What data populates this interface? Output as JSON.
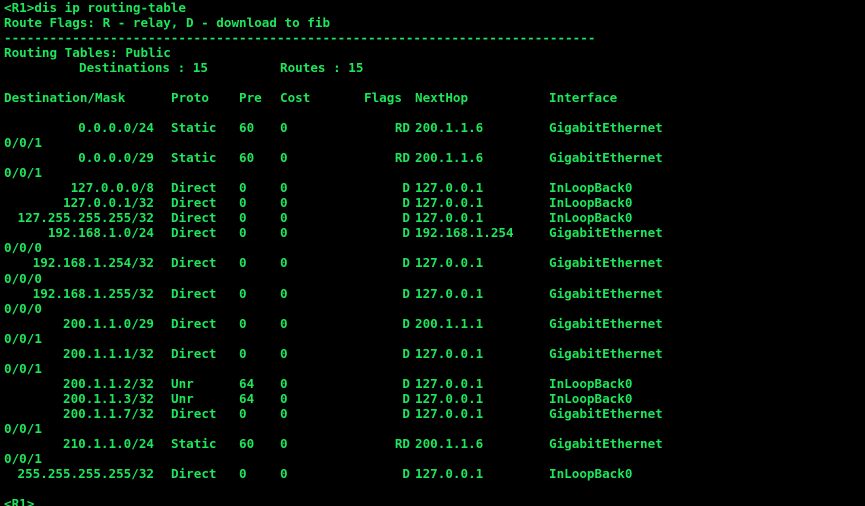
{
  "terminal": {
    "command_line": "<R1>dis ip routing-table",
    "flags_line": "Route Flags: R - relay, D - download to fib",
    "separator": "------------------------------------------------------------------------------",
    "table_title": "Routing Tables: Public",
    "destinations_label": "Destinations : 15",
    "routes_label": "Routes : 15",
    "prompt": "<R1>"
  },
  "headers": {
    "dest": "Destination/Mask",
    "proto": "Proto",
    "pre": "Pre",
    "cost": "Cost",
    "flags": "Flags",
    "nexthop": "NextHop",
    "interface": "Interface"
  },
  "routes": [
    {
      "dest": "0.0.0.0/24",
      "proto": "Static",
      "pre": "60",
      "cost": "0",
      "flags": "RD",
      "nexthop": "200.1.1.6",
      "iface": "GigabitEthernet",
      "iface2": "0/0/1"
    },
    {
      "dest": "0.0.0.0/29",
      "proto": "Static",
      "pre": "60",
      "cost": "0",
      "flags": "RD",
      "nexthop": "200.1.1.6",
      "iface": "GigabitEthernet",
      "iface2": "0/0/1"
    },
    {
      "dest": "127.0.0.0/8",
      "proto": "Direct",
      "pre": "0",
      "cost": "0",
      "flags": "D",
      "nexthop": "127.0.0.1",
      "iface": "InLoopBack0",
      "iface2": ""
    },
    {
      "dest": "127.0.0.1/32",
      "proto": "Direct",
      "pre": "0",
      "cost": "0",
      "flags": "D",
      "nexthop": "127.0.0.1",
      "iface": "InLoopBack0",
      "iface2": ""
    },
    {
      "dest": "127.255.255.255/32",
      "proto": "Direct",
      "pre": "0",
      "cost": "0",
      "flags": "D",
      "nexthop": "127.0.0.1",
      "iface": "InLoopBack0",
      "iface2": ""
    },
    {
      "dest": "192.168.1.0/24",
      "proto": "Direct",
      "pre": "0",
      "cost": "0",
      "flags": "D",
      "nexthop": "192.168.1.254",
      "iface": "GigabitEthernet",
      "iface2": "0/0/0"
    },
    {
      "dest": "192.168.1.254/32",
      "proto": "Direct",
      "pre": "0",
      "cost": "0",
      "flags": "D",
      "nexthop": "127.0.0.1",
      "iface": "GigabitEthernet",
      "iface2": "0/0/0"
    },
    {
      "dest": "192.168.1.255/32",
      "proto": "Direct",
      "pre": "0",
      "cost": "0",
      "flags": "D",
      "nexthop": "127.0.0.1",
      "iface": "GigabitEthernet",
      "iface2": "0/0/0"
    },
    {
      "dest": "200.1.1.0/29",
      "proto": "Direct",
      "pre": "0",
      "cost": "0",
      "flags": "D",
      "nexthop": "200.1.1.1",
      "iface": "GigabitEthernet",
      "iface2": "0/0/1"
    },
    {
      "dest": "200.1.1.1/32",
      "proto": "Direct",
      "pre": "0",
      "cost": "0",
      "flags": "D",
      "nexthop": "127.0.0.1",
      "iface": "GigabitEthernet",
      "iface2": "0/0/1"
    },
    {
      "dest": "200.1.1.2/32",
      "proto": "Unr",
      "pre": "64",
      "cost": "0",
      "flags": "D",
      "nexthop": "127.0.0.1",
      "iface": "InLoopBack0",
      "iface2": ""
    },
    {
      "dest": "200.1.1.3/32",
      "proto": "Unr",
      "pre": "64",
      "cost": "0",
      "flags": "D",
      "nexthop": "127.0.0.1",
      "iface": "InLoopBack0",
      "iface2": ""
    },
    {
      "dest": "200.1.1.7/32",
      "proto": "Direct",
      "pre": "0",
      "cost": "0",
      "flags": "D",
      "nexthop": "127.0.0.1",
      "iface": "GigabitEthernet",
      "iface2": "0/0/1"
    },
    {
      "dest": "210.1.1.0/24",
      "proto": "Static",
      "pre": "60",
      "cost": "0",
      "flags": "RD",
      "nexthop": "200.1.1.6",
      "iface": "GigabitEthernet",
      "iface2": "0/0/1"
    },
    {
      "dest": "255.255.255.255/32",
      "proto": "Direct",
      "pre": "0",
      "cost": "0",
      "flags": "D",
      "nexthop": "127.0.0.1",
      "iface": "InLoopBack0",
      "iface2": ""
    }
  ],
  "colors": {
    "background": "#000000",
    "text": "#1ee65a"
  }
}
